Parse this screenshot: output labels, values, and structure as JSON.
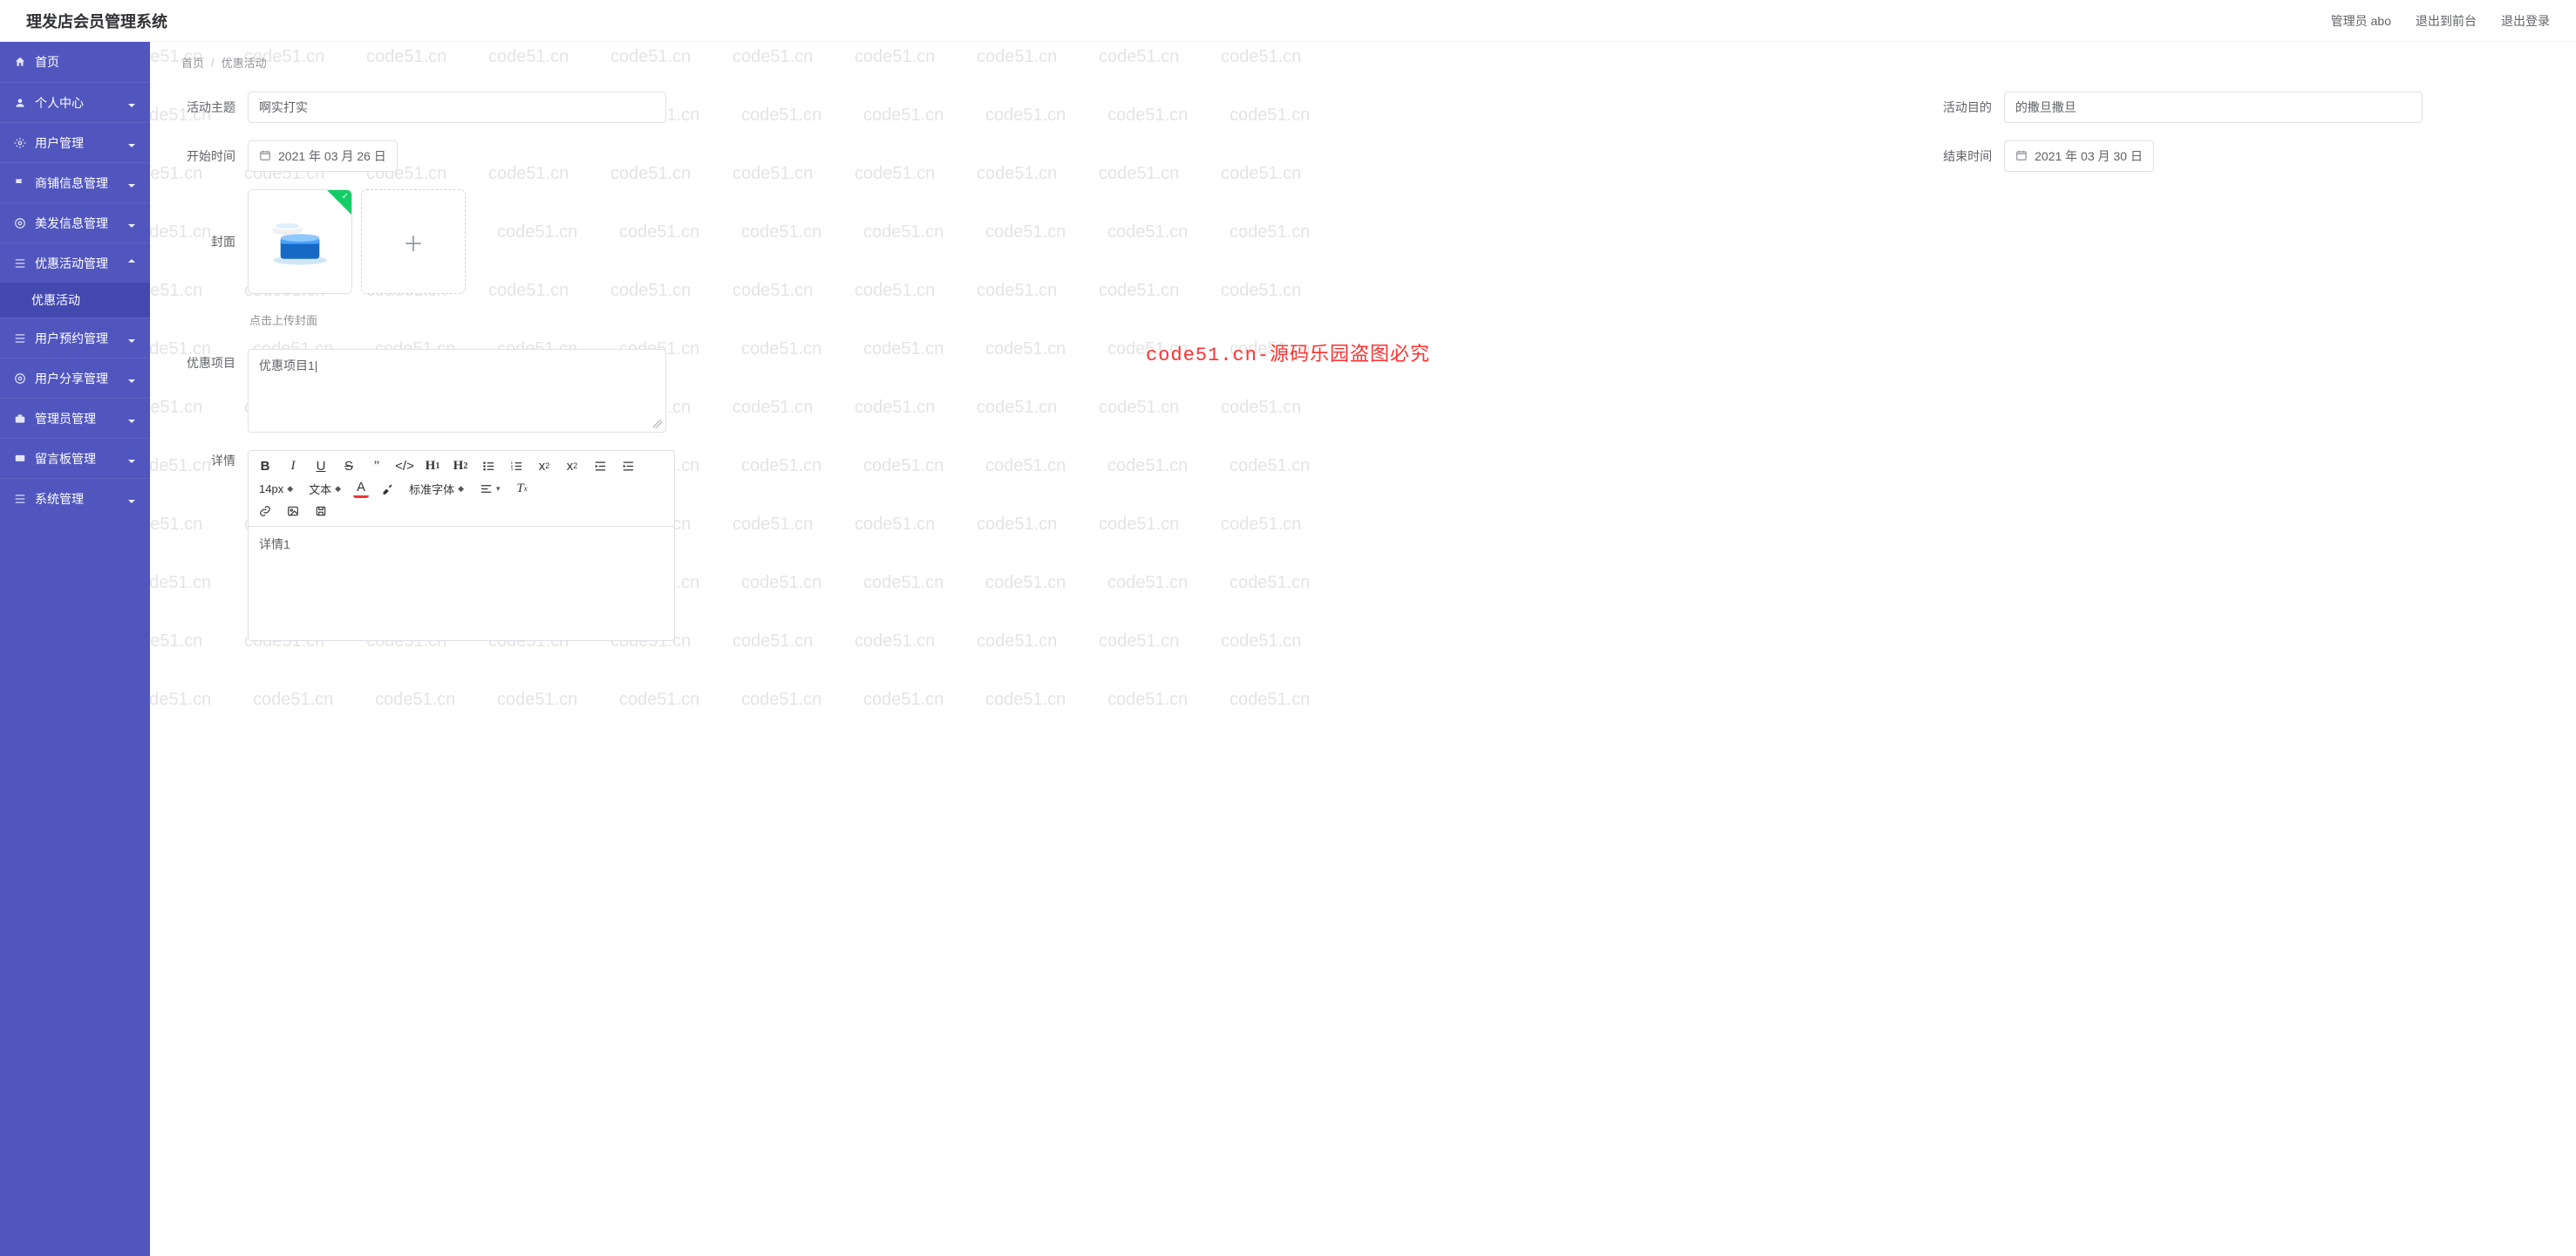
{
  "app": {
    "title": "理发店会员管理系统"
  },
  "header": {
    "admin_label": "管理员 abo",
    "exit_front": "退出到前台",
    "logout": "退出登录"
  },
  "sidebar": {
    "items": [
      {
        "label": "首页",
        "icon": "home-icon"
      },
      {
        "label": "个人中心",
        "icon": "user-icon"
      },
      {
        "label": "用户管理",
        "icon": "gear-icon"
      },
      {
        "label": "商铺信息管理",
        "icon": "flag-icon"
      },
      {
        "label": "美发信息管理",
        "icon": "gear-icon"
      },
      {
        "label": "优惠活动管理",
        "icon": "list-icon"
      },
      {
        "label": "用户预约管理",
        "icon": "list-icon"
      },
      {
        "label": "用户分享管理",
        "icon": "gear-icon"
      },
      {
        "label": "管理员管理",
        "icon": "briefcase-icon"
      },
      {
        "label": "留言板管理",
        "icon": "message-icon"
      },
      {
        "label": "系统管理",
        "icon": "list-icon"
      }
    ],
    "submenu_active": "优惠活动"
  },
  "breadcrumb": {
    "home": "首页",
    "sep": "/",
    "current": "优惠活动"
  },
  "form": {
    "topic_label": "活动主题",
    "topic_value": "啊实打实",
    "purpose_label": "活动目的",
    "purpose_value": "的撒旦撒旦",
    "start_label": "开始时间",
    "start_value": "2021 年 03 月 26 日",
    "end_label": "结束时间",
    "end_value": "2021 年 03 月 30 日",
    "cover_label": "封面",
    "upload_hint": "点击上传封面",
    "project_label": "优惠项目",
    "project_value": "优惠项目1|",
    "detail_label": "详情",
    "detail_content": "详情1"
  },
  "editor": {
    "fontsize": "14px",
    "textstyle": "文本",
    "a_color": "A",
    "highlight": "A",
    "fontfamily": "标准字体"
  },
  "watermark_text": "code51.cn",
  "banner": "code51.cn-源码乐园盗图必究"
}
